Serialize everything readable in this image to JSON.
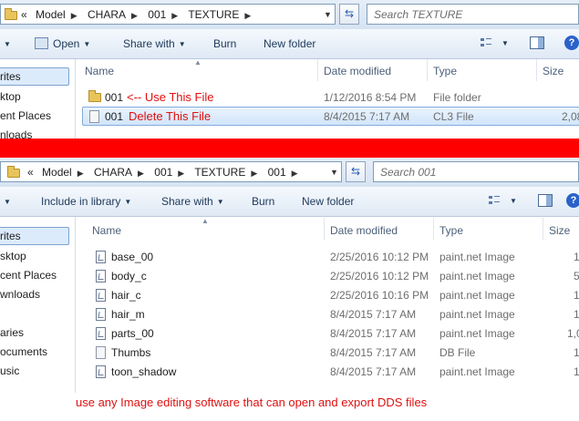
{
  "top_window": {
    "breadcrumb": [
      "«",
      "Model",
      "CHARA",
      "001",
      "TEXTURE"
    ],
    "search_placeholder": "Search TEXTURE",
    "toolbar": {
      "open": "Open",
      "share_with": "Share with",
      "burn": "Burn",
      "new_folder": "New folder"
    },
    "nav": [
      "rites",
      "ktop",
      "ent Places",
      "nloads"
    ],
    "columns": {
      "name": "Name",
      "date": "Date modified",
      "type": "Type",
      "size": "Size"
    },
    "rows": [
      {
        "name": "001",
        "note": "<-- Use This File",
        "date": "1/12/2016 8:54 PM",
        "type": "File folder",
        "size": "",
        "kind": "folder"
      },
      {
        "name": "001",
        "note": "Delete This File",
        "date": "8/4/2015 7:17 AM",
        "type": "CL3 File",
        "size": "2,08",
        "kind": "file"
      }
    ]
  },
  "bottom_window": {
    "breadcrumb": [
      "«",
      "Model",
      "CHARA",
      "001",
      "TEXTURE",
      "001"
    ],
    "search_placeholder": "Search 001",
    "toolbar": {
      "include": "Include in library",
      "share_with": "Share with",
      "burn": "Burn",
      "new_folder": "New folder"
    },
    "nav": [
      "rites",
      "sktop",
      "cent Places",
      "wnloads",
      "aries",
      "ocuments",
      "usic"
    ],
    "columns": {
      "name": "Name",
      "date": "Date modified",
      "type": "Type",
      "size": "Size"
    },
    "rows": [
      {
        "name": "base_00",
        "date": "2/25/2016 10:12 PM",
        "type": "paint.net Image",
        "size": "1"
      },
      {
        "name": "body_c",
        "date": "2/25/2016 10:12 PM",
        "type": "paint.net Image",
        "size": "5"
      },
      {
        "name": "hair_c",
        "date": "2/25/2016 10:16 PM",
        "type": "paint.net Image",
        "size": "1"
      },
      {
        "name": "hair_m",
        "date": "8/4/2015 7:17 AM",
        "type": "paint.net Image",
        "size": "1"
      },
      {
        "name": "parts_00",
        "date": "8/4/2015 7:17 AM",
        "type": "paint.net Image",
        "size": "1,0"
      },
      {
        "name": "Thumbs",
        "date": "8/4/2015 7:17 AM",
        "type": "DB File",
        "size": "1"
      },
      {
        "name": "toon_shadow",
        "date": "8/4/2015 7:17 AM",
        "type": "paint.net Image",
        "size": "1"
      }
    ]
  },
  "footer_note": "use any Image editing software that can open and export DDS files",
  "colors": {
    "annotation": "#e01010",
    "separator_bar": "#ff0000",
    "accent": "#2a62c9"
  }
}
